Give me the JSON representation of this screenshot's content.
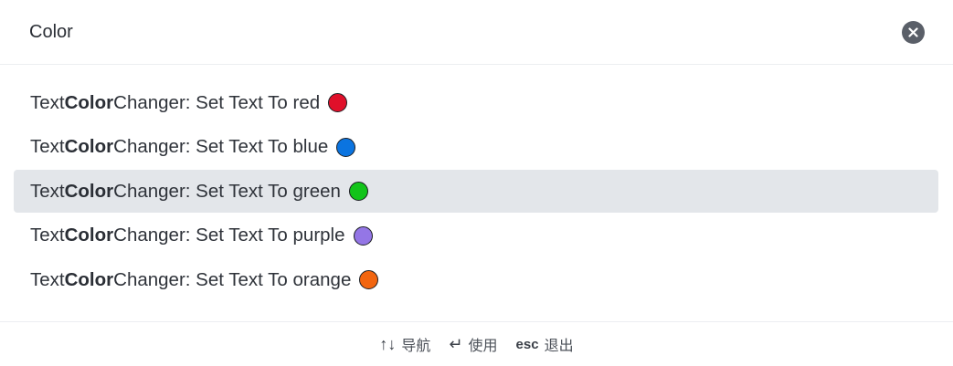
{
  "search": {
    "value": "Color",
    "query_highlight": "Color"
  },
  "results": [
    {
      "prefix": "Text ",
      "match": "Color",
      "suffix": " Changer: Set Text To red",
      "swatch_color": "#e0102a",
      "selected": false
    },
    {
      "prefix": "Text ",
      "match": "Color",
      "suffix": " Changer: Set Text To blue",
      "swatch_color": "#0b74e0",
      "selected": false
    },
    {
      "prefix": "Text ",
      "match": "Color",
      "suffix": " Changer: Set Text To green",
      "swatch_color": "#12c41a",
      "selected": true
    },
    {
      "prefix": "Text ",
      "match": "Color",
      "suffix": " Changer: Set Text To purple",
      "swatch_color": "#9476e6",
      "selected": false
    },
    {
      "prefix": "Text ",
      "match": "Color",
      "suffix": " Changer: Set Text To orange",
      "swatch_color": "#f2650f",
      "selected": false
    }
  ],
  "footer": {
    "navigate_keys": "↑↓",
    "navigate_label": "导航",
    "enter_key": "↵",
    "enter_label": "使用",
    "esc_key": "esc",
    "esc_label": "退出"
  },
  "colors": {
    "selected_background": "#e3e6ea",
    "clear_button": "#5a5f68"
  }
}
